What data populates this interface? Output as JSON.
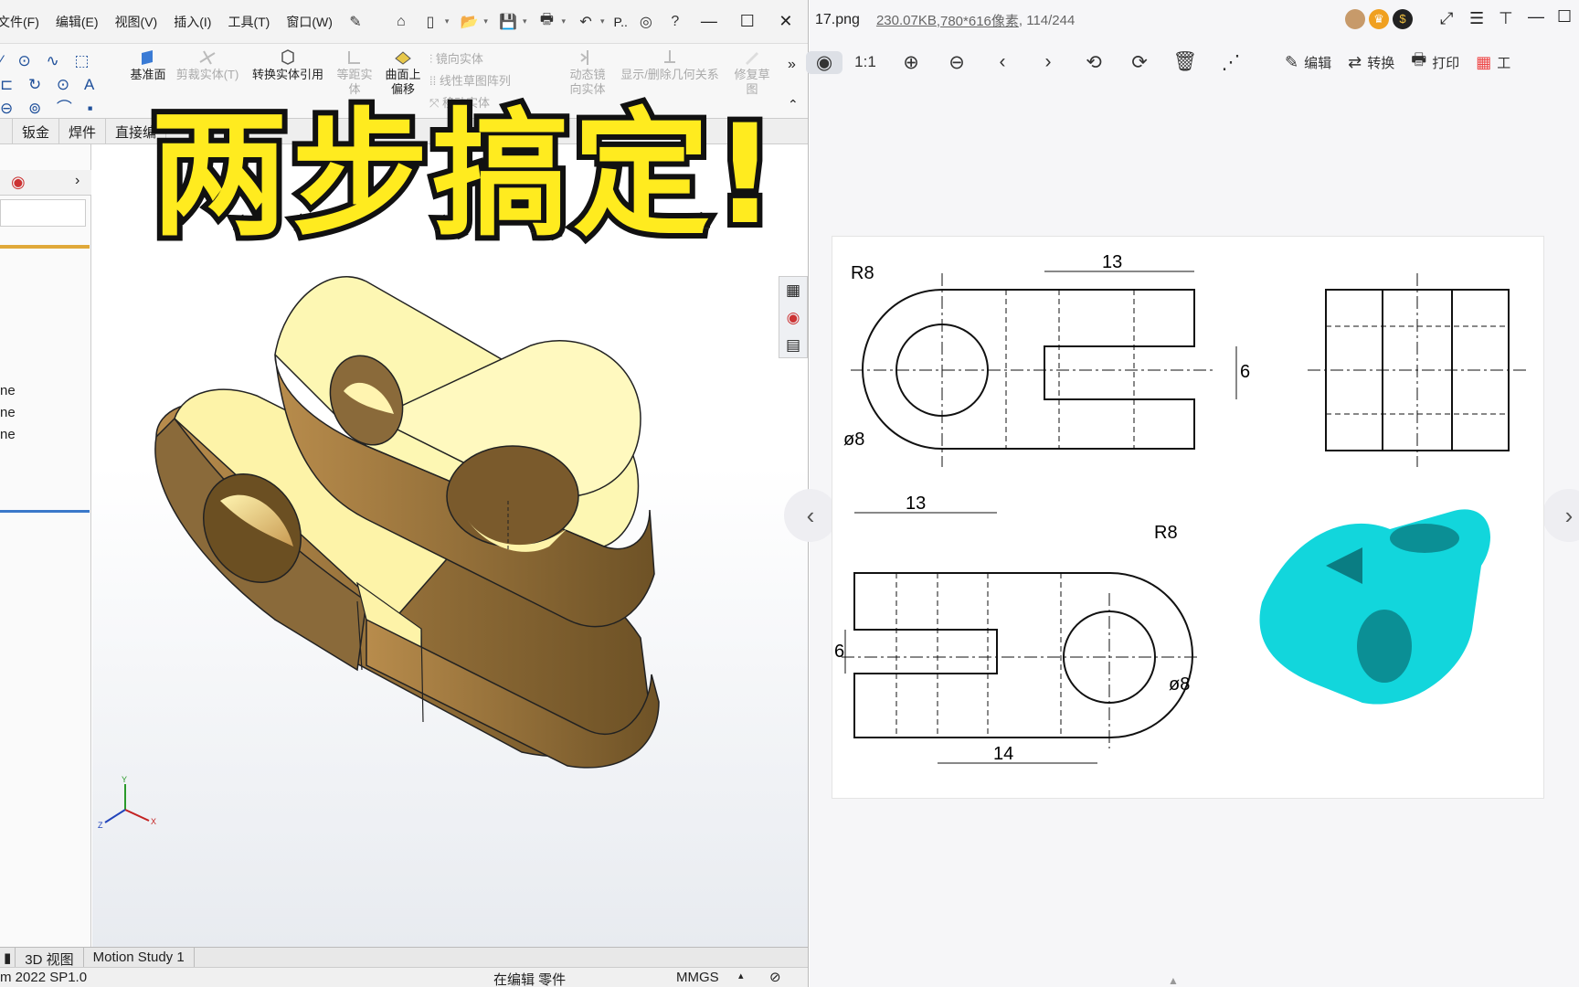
{
  "cad": {
    "menu": [
      "文件(F)",
      "编辑(E)",
      "视图(V)",
      "插入(I)",
      "工具(T)",
      "窗口(W)"
    ],
    "quick_access_search": "P..",
    "ribbon": {
      "buttons": [
        "基准面",
        "剪裁实体(T)",
        "转换实体引用",
        "等距实体",
        "曲面上偏移",
        "动态镜向实体",
        "显示/删除几何关系",
        "修复草图"
      ],
      "small": [
        "镜向实体",
        "线性草图阵列",
        "移动实体"
      ]
    },
    "tabs": [
      "钣金",
      "焊件",
      "直接编"
    ],
    "tree_items": [
      "ne",
      "ne",
      "ne"
    ],
    "bottom_tabs": [
      "3D 视图",
      "Motion Study 1"
    ],
    "status": {
      "version": "m 2022 SP1.0",
      "mode": "在编辑 零件",
      "units": "MMGS"
    },
    "triad": {
      "x": "X",
      "y": "Y",
      "z": "Z"
    }
  },
  "viewer": {
    "filename": "17.png",
    "filesize": "230.07KB",
    "dimensions": ",780*616像素",
    "page": ", 114/244",
    "zoom_label": "1:1",
    "actions": [
      "编辑",
      "转换",
      "打印",
      "工"
    ]
  },
  "drawing": {
    "dims": {
      "top_width": "13",
      "top_radius": "R8",
      "top_dia": "ø8",
      "top_slot": "6",
      "bot_width": "13",
      "bot_radius": "R8",
      "bot_dia": "ø8",
      "bot_slot": "6",
      "bot_len": "14"
    }
  },
  "headline": "两步搞定!",
  "colors": {
    "part_face": "#fdf7b3",
    "part_side": "#8a6a3a",
    "iso_model": "#12d6dc",
    "headline": "#ffeb1f"
  }
}
